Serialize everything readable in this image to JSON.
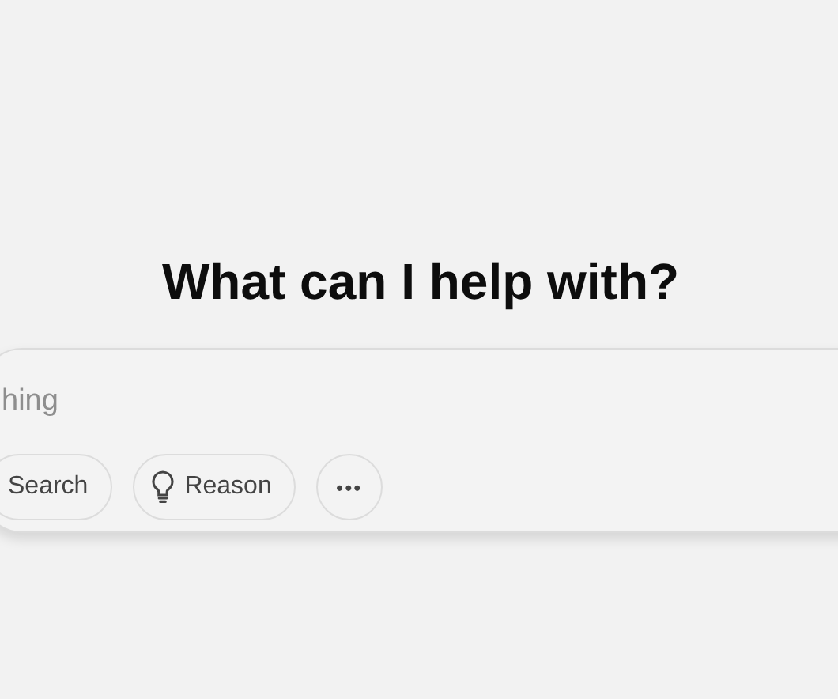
{
  "heading": "What can I help with?",
  "composer": {
    "placeholder": "hing",
    "tools": [
      {
        "kind": "text",
        "label": "Search"
      },
      {
        "kind": "bulb",
        "label": "Reason"
      },
      {
        "kind": "more",
        "label": "•••"
      }
    ]
  }
}
